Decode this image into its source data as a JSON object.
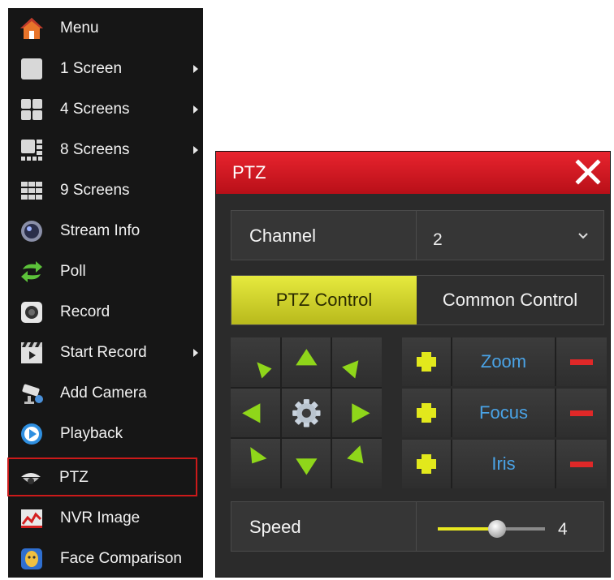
{
  "menu": {
    "items": [
      {
        "label": "Menu",
        "icon": "home-icon",
        "submenu": false
      },
      {
        "label": "1 Screen",
        "icon": "single-screen-icon",
        "submenu": true
      },
      {
        "label": "4 Screens",
        "icon": "four-screens-icon",
        "submenu": true
      },
      {
        "label": "8 Screens",
        "icon": "eight-screens-icon",
        "submenu": true
      },
      {
        "label": "9 Screens",
        "icon": "nine-screens-icon",
        "submenu": false
      },
      {
        "label": "Stream Info",
        "icon": "stream-info-icon",
        "submenu": false
      },
      {
        "label": "Poll",
        "icon": "poll-icon",
        "submenu": false
      },
      {
        "label": "Record",
        "icon": "record-icon",
        "submenu": false
      },
      {
        "label": "Start Record",
        "icon": "start-record-icon",
        "submenu": true
      },
      {
        "label": "Add Camera",
        "icon": "add-camera-icon",
        "submenu": false
      },
      {
        "label": "Playback",
        "icon": "playback-icon",
        "submenu": false
      },
      {
        "label": "PTZ",
        "icon": "ptz-icon",
        "submenu": false,
        "selected": true
      },
      {
        "label": "NVR Image",
        "icon": "nvr-image-icon",
        "submenu": false
      },
      {
        "label": "Face Comparison",
        "icon": "face-comparison-icon",
        "submenu": false
      }
    ]
  },
  "dialog": {
    "title": "PTZ",
    "channel_label": "Channel",
    "channel_value": "2",
    "tabs": {
      "ptz_control": "PTZ Control",
      "common_control": "Common Control",
      "active": "ptz_control"
    },
    "lens": {
      "zoom": "Zoom",
      "focus": "Focus",
      "iris": "Iris"
    },
    "speed_label": "Speed",
    "speed_value": "4",
    "speed_fraction": 0.55
  },
  "colors": {
    "title_bar": "#d41a24",
    "active_tab": "#d6d92c",
    "arrow_green": "#8fd61a",
    "plus_yellow": "#e2e81c",
    "minus_red": "#e02828",
    "lens_text": "#4aa3e6",
    "selected_outline": "#cc1a1a"
  }
}
